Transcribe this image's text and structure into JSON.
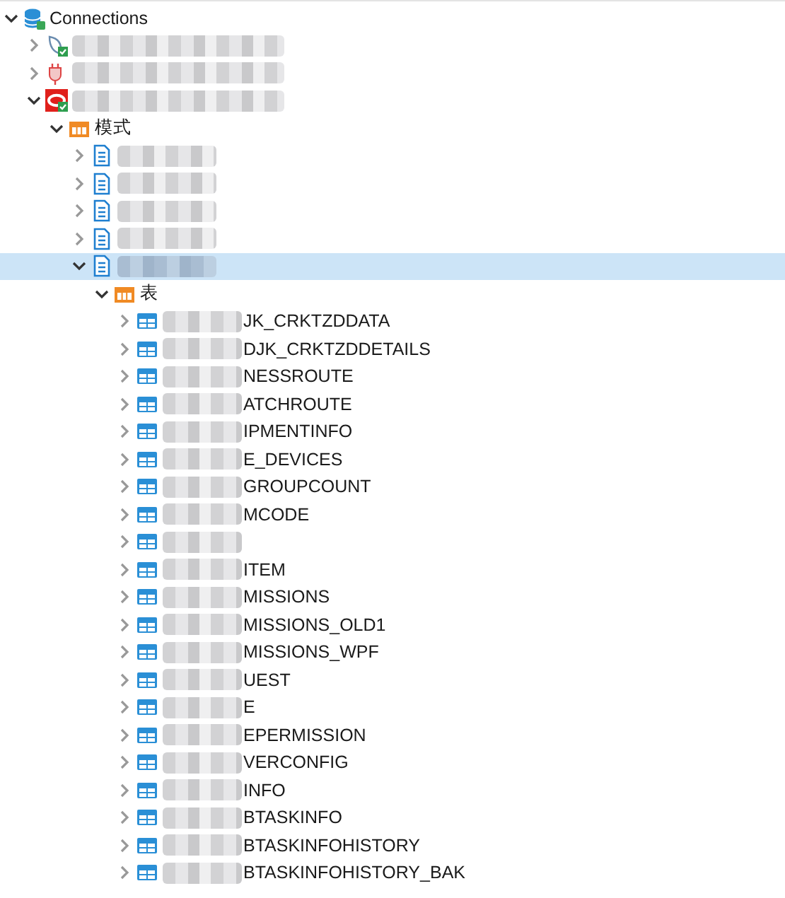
{
  "tree": {
    "kind": "root",
    "label": "Connections",
    "expanded": true,
    "selected": false,
    "blurred": false,
    "children": [
      {
        "kind": "server",
        "connected": true,
        "expanded": false,
        "selected": false,
        "blurred": true
      },
      {
        "kind": "plug",
        "connected": false,
        "expanded": false,
        "selected": false,
        "blurred": true
      },
      {
        "kind": "oracle",
        "connected": true,
        "expanded": true,
        "selected": false,
        "blurred": true,
        "children": [
          {
            "kind": "folder",
            "label": "模式",
            "expanded": true,
            "selected": false,
            "blurred": false,
            "children": [
              {
                "kind": "schema",
                "expanded": false,
                "selected": false,
                "blurred": true
              },
              {
                "kind": "schema",
                "expanded": false,
                "selected": false,
                "blurred": true
              },
              {
                "kind": "schema",
                "expanded": false,
                "selected": false,
                "blurred": true
              },
              {
                "kind": "schema",
                "expanded": false,
                "selected": false,
                "blurred": true
              },
              {
                "kind": "schema",
                "expanded": true,
                "selected": true,
                "blurred": true,
                "children": [
                  {
                    "kind": "folder",
                    "label": "表",
                    "expanded": true,
                    "selected": false,
                    "blurred": false,
                    "children": [
                      {
                        "kind": "table",
                        "label": "JK_CRKTZDDATA",
                        "expanded": false,
                        "selected": false,
                        "blurred": true
                      },
                      {
                        "kind": "table",
                        "label": "DJK_CRKTZDDETAILS",
                        "expanded": false,
                        "selected": false,
                        "blurred": true
                      },
                      {
                        "kind": "table",
                        "label": "NESSROUTE",
                        "expanded": false,
                        "selected": false,
                        "blurred": true
                      },
                      {
                        "kind": "table",
                        "label": "ATCHROUTE",
                        "expanded": false,
                        "selected": false,
                        "blurred": true
                      },
                      {
                        "kind": "table",
                        "label": "IPMENTINFO",
                        "expanded": false,
                        "selected": false,
                        "blurred": true
                      },
                      {
                        "kind": "table",
                        "label": "E_DEVICES",
                        "expanded": false,
                        "selected": false,
                        "blurred": true
                      },
                      {
                        "kind": "table",
                        "label": "GROUPCOUNT",
                        "expanded": false,
                        "selected": false,
                        "blurred": true
                      },
                      {
                        "kind": "table",
                        "label": "MCODE",
                        "expanded": false,
                        "selected": false,
                        "blurred": true
                      },
                      {
                        "kind": "table",
                        "expanded": false,
                        "selected": false,
                        "blurred": true
                      },
                      {
                        "kind": "table",
                        "label": "ITEM",
                        "expanded": false,
                        "selected": false,
                        "blurred": true
                      },
                      {
                        "kind": "table",
                        "label": "MISSIONS",
                        "expanded": false,
                        "selected": false,
                        "blurred": true
                      },
                      {
                        "kind": "table",
                        "label": "MISSIONS_OLD1",
                        "expanded": false,
                        "selected": false,
                        "blurred": true
                      },
                      {
                        "kind": "table",
                        "label": "MISSIONS_WPF",
                        "expanded": false,
                        "selected": false,
                        "blurred": true
                      },
                      {
                        "kind": "table",
                        "label": "UEST",
                        "expanded": false,
                        "selected": false,
                        "blurred": true
                      },
                      {
                        "kind": "table",
                        "label": "E",
                        "expanded": false,
                        "selected": false,
                        "blurred": true
                      },
                      {
                        "kind": "table",
                        "label": "EPERMISSION",
                        "expanded": false,
                        "selected": false,
                        "blurred": true
                      },
                      {
                        "kind": "table",
                        "label": "VERCONFIG",
                        "expanded": false,
                        "selected": false,
                        "blurred": true
                      },
                      {
                        "kind": "table",
                        "label": "INFO",
                        "expanded": false,
                        "selected": false,
                        "blurred": true
                      },
                      {
                        "kind": "table",
                        "label": "BTASKINFO",
                        "expanded": false,
                        "selected": false,
                        "blurred": true
                      },
                      {
                        "kind": "table",
                        "label": "BTASKINFOHISTORY",
                        "expanded": false,
                        "selected": false,
                        "blurred": true
                      },
                      {
                        "kind": "table",
                        "label": "BTASKINFOHISTORY_BAK",
                        "expanded": false,
                        "selected": false,
                        "blurred": true
                      }
                    ]
                  }
                ]
              }
            ]
          }
        ]
      }
    ]
  }
}
